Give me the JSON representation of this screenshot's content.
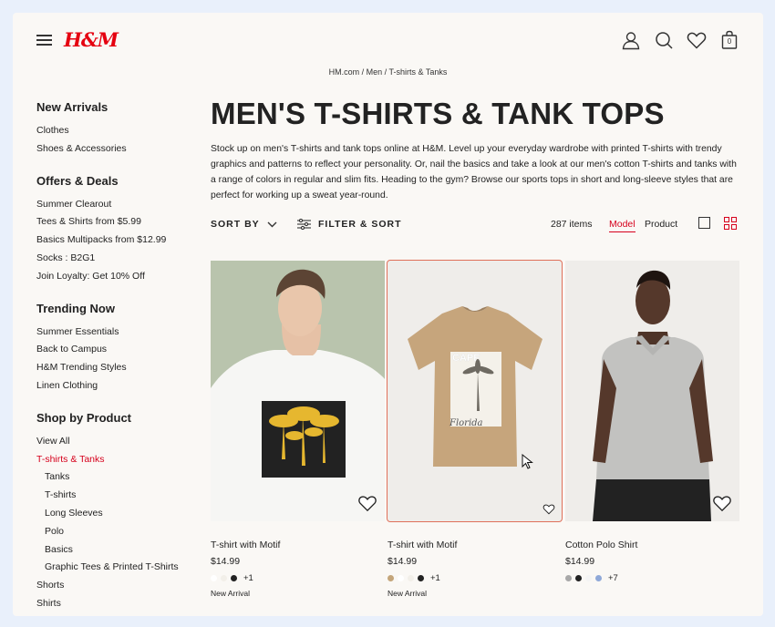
{
  "header": {
    "logo": "H&M",
    "cart_count": "0"
  },
  "breadcrumb": "HM.com / Men / T-shirts & Tanks",
  "sidebar": [
    {
      "heading": "New Arrivals",
      "items": [
        {
          "label": "Clothes"
        },
        {
          "label": "Shoes & Accessories"
        }
      ]
    },
    {
      "heading": "Offers & Deals",
      "items": [
        {
          "label": "Summer Clearout"
        },
        {
          "label": "Tees & Shirts from $5.99"
        },
        {
          "label": "Basics Multipacks from $12.99"
        },
        {
          "label": "Socks : B2G1"
        },
        {
          "label": "Join Loyalty: Get 10% Off"
        }
      ]
    },
    {
      "heading": "Trending Now",
      "items": [
        {
          "label": "Summer Essentials"
        },
        {
          "label": "Back to Campus"
        },
        {
          "label": "H&M Trending Styles"
        },
        {
          "label": "Linen Clothing"
        }
      ]
    },
    {
      "heading": "Shop by Product",
      "items": [
        {
          "label": "View All"
        },
        {
          "label": "T-shirts & Tanks",
          "active": true
        },
        {
          "label": "Tanks",
          "sub": true
        },
        {
          "label": "T-shirts",
          "sub": true
        },
        {
          "label": "Long Sleeves",
          "sub": true
        },
        {
          "label": "Polo",
          "sub": true
        },
        {
          "label": "Basics",
          "sub": true
        },
        {
          "label": "Graphic Tees & Printed T-Shirts",
          "sub": true
        },
        {
          "label": "Shorts"
        },
        {
          "label": "Shirts"
        }
      ]
    }
  ],
  "main": {
    "title": "MEN'S T-SHIRTS & TANK TOPS",
    "description": "Stock up on men's T-shirts and tank tops online at H&M. Level up your everyday wardrobe with printed T-shirts with trendy graphics and patterns to reflect your personality. Or, nail the basics and take a look at our men's cotton T-shirts and tanks with a range of colors in regular and slim fits. Heading to the gym? Browse our sports tops in short and long-sleeve styles that are perfect for working up a sweat year-round."
  },
  "toolbar": {
    "sort_label": "SORT BY",
    "filter_label": "FILTER & SORT",
    "item_count": "287 items",
    "view_model": "Model",
    "view_product": "Product"
  },
  "products": [
    {
      "name": "T-shirt with Motif",
      "price": "$14.99",
      "swatches": [
        "#ffffff",
        "#f2efe9",
        "#222222"
      ],
      "more": "+1",
      "badge": "New Arrival"
    },
    {
      "name": "T-shirt with Motif",
      "price": "$14.99",
      "swatches": [
        "#c4a57a",
        "#ffffff",
        "#f2efe9",
        "#222222"
      ],
      "more": "+1",
      "badge": "New Arrival",
      "selected": true
    },
    {
      "name": "Cotton Polo Shirt",
      "price": "$14.99",
      "swatches": [
        "#a8a8a8",
        "#222222",
        "#f4f4f4",
        "#8fa8d8"
      ],
      "more": "+7",
      "badge": ""
    }
  ],
  "product_images": [
    {
      "print_text": ""
    },
    {
      "print_text": "CAPE",
      "print_script": "Florida"
    },
    {
      "print_text": ""
    }
  ],
  "colors": {
    "accent": "#d6001c",
    "selected_outline": "#e0705a",
    "page_bg": "#faf8f5"
  }
}
